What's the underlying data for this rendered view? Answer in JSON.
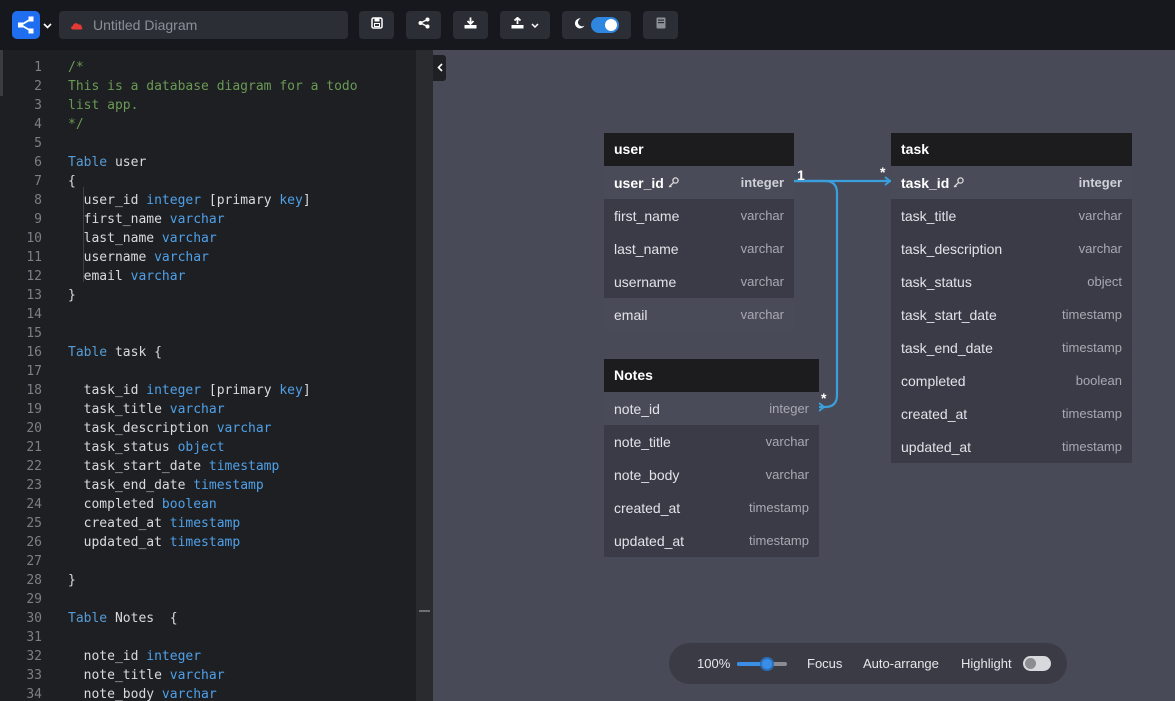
{
  "header": {
    "diagram_title": "Untitled Diagram",
    "brand_color": "#1f6ef0",
    "cloud_color": "#e53935",
    "buttons": [
      "save-icon",
      "share-icon",
      "download-icon",
      "upload-icon",
      "theme-toggle",
      "docs-icon"
    ]
  },
  "editor": {
    "lines": [
      {
        "n": "1",
        "t": "/*",
        "k": "comment"
      },
      {
        "n": "2",
        "t": "This is a database diagram for a todo",
        "k": "comment"
      },
      {
        "n": "3",
        "t": "list app.",
        "k": "comment"
      },
      {
        "n": "4",
        "t": "*/",
        "k": "comment"
      },
      {
        "n": "5",
        "t": "",
        "k": "plain"
      },
      {
        "n": "6",
        "kw": "Table",
        "rest": " user",
        "k": "table"
      },
      {
        "n": "7",
        "t": "{",
        "k": "plain"
      },
      {
        "n": "8",
        "name": "  user_id",
        "type": "integer",
        "extra": " [primary ",
        "extra_kw": "key",
        "tail": "]",
        "k": "field-pk"
      },
      {
        "n": "9",
        "name": "  first_name",
        "type": "varchar",
        "k": "field"
      },
      {
        "n": "10",
        "name": "  last_name",
        "type": "varchar",
        "k": "field"
      },
      {
        "n": "11",
        "name": "  username",
        "type": "varchar",
        "k": "field"
      },
      {
        "n": "12",
        "name": "  email",
        "type": "varchar",
        "k": "field"
      },
      {
        "n": "13",
        "t": "}",
        "k": "plain"
      },
      {
        "n": "14",
        "t": "",
        "k": "plain"
      },
      {
        "n": "15",
        "t": "",
        "k": "plain"
      },
      {
        "n": "16",
        "kw": "Table",
        "rest": " task {",
        "k": "table"
      },
      {
        "n": "17",
        "t": "",
        "k": "plain"
      },
      {
        "n": "18",
        "name": "  task_id",
        "type": "integer",
        "extra": " [primary ",
        "extra_kw": "key",
        "tail": "]",
        "k": "field-pk"
      },
      {
        "n": "19",
        "name": "  task_title",
        "type": "varchar",
        "k": "field"
      },
      {
        "n": "20",
        "name": "  task_description",
        "type": "varchar",
        "k": "field"
      },
      {
        "n": "21",
        "name": "  task_status",
        "type": "object",
        "k": "field"
      },
      {
        "n": "22",
        "name": "  task_start_date",
        "type": "timestamp",
        "k": "field"
      },
      {
        "n": "23",
        "name": "  task_end_date",
        "type": "timestamp",
        "k": "field"
      },
      {
        "n": "24",
        "name": "  completed",
        "type": "boolean",
        "k": "field"
      },
      {
        "n": "25",
        "name": "  created_at",
        "type": "timestamp",
        "k": "field"
      },
      {
        "n": "26",
        "name": "  updated_at",
        "type": "timestamp",
        "k": "field"
      },
      {
        "n": "27",
        "t": "",
        "k": "plain"
      },
      {
        "n": "28",
        "t": "}",
        "k": "plain"
      },
      {
        "n": "29",
        "t": "",
        "k": "plain"
      },
      {
        "n": "30",
        "kw": "Table",
        "rest": " Notes  {",
        "k": "table"
      },
      {
        "n": "31",
        "t": "",
        "k": "plain"
      },
      {
        "n": "32",
        "name": "  note_id",
        "type": "integer",
        "k": "field"
      },
      {
        "n": "33",
        "name": "  note_title",
        "type": "varchar",
        "k": "field"
      },
      {
        "n": "34",
        "name": "  note_body",
        "type": "varchar",
        "k": "field"
      }
    ]
  },
  "diagram": {
    "tables": [
      {
        "id": "user",
        "name": "user",
        "fields": [
          {
            "name": "user_id",
            "type": "integer",
            "pk": true
          },
          {
            "name": "first_name",
            "type": "varchar"
          },
          {
            "name": "last_name",
            "type": "varchar"
          },
          {
            "name": "username",
            "type": "varchar"
          },
          {
            "name": "email",
            "type": "varchar",
            "highlight": true
          }
        ]
      },
      {
        "id": "task",
        "name": "task",
        "fields": [
          {
            "name": "task_id",
            "type": "integer",
            "pk": true
          },
          {
            "name": "task_title",
            "type": "varchar"
          },
          {
            "name": "task_description",
            "type": "varchar"
          },
          {
            "name": "task_status",
            "type": "object"
          },
          {
            "name": "task_start_date",
            "type": "timestamp"
          },
          {
            "name": "task_end_date",
            "type": "timestamp"
          },
          {
            "name": "completed",
            "type": "boolean"
          },
          {
            "name": "created_at",
            "type": "timestamp"
          },
          {
            "name": "updated_at",
            "type": "timestamp"
          }
        ]
      },
      {
        "id": "notes",
        "name": "Notes",
        "fields": [
          {
            "name": "note_id",
            "type": "integer",
            "highlight": true
          },
          {
            "name": "note_title",
            "type": "varchar"
          },
          {
            "name": "note_body",
            "type": "varchar"
          },
          {
            "name": "created_at",
            "type": "timestamp"
          },
          {
            "name": "updated_at",
            "type": "timestamp"
          }
        ]
      }
    ],
    "relations": [
      {
        "from": "user.user_id",
        "to": "task.task_id",
        "from_card": "1",
        "to_card": "*"
      },
      {
        "from": "user.user_id",
        "to": "Notes.note_id",
        "from_card": "1",
        "to_card": "*"
      }
    ],
    "relation_color": "#3a9fdc"
  },
  "zoom_bar": {
    "zoom_label": "100%",
    "zoom_level_fraction": 0.6,
    "focus_label": "Focus",
    "auto_arrange_label": "Auto-arrange",
    "highlight_label": "Highlight",
    "highlight_on": false
  }
}
